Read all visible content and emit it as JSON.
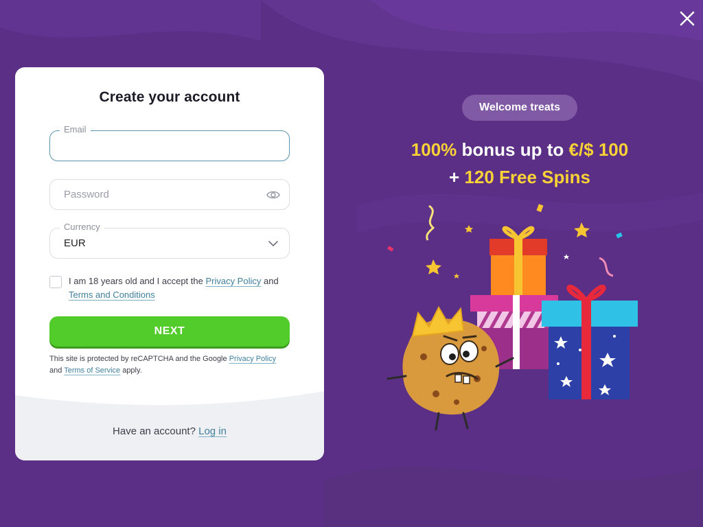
{
  "modal": {
    "title": "Create your account",
    "email": {
      "label": "Email",
      "value": "",
      "placeholder": ""
    },
    "password": {
      "placeholder": "Password"
    },
    "currency": {
      "label": "Currency",
      "value": "EUR"
    },
    "consent": {
      "text_before": "I am 18 years old and I accept the ",
      "privacy_link": "Privacy Policy",
      "text_middle": " and ",
      "terms_link": "Terms and Conditions"
    },
    "next_label": "NEXT",
    "recaptcha": {
      "text_before": "This site is protected by reCAPTCHA and the Google ",
      "privacy_link": "Privacy Policy",
      "text_middle": " and ",
      "terms_link": "Terms of Service",
      "text_after": " apply."
    },
    "login": {
      "prompt": "Have an account?",
      "link": "Log in"
    }
  },
  "promo": {
    "badge": "Welcome treats",
    "line1_a": "100%",
    "line1_b": " bonus up to ",
    "line1_c": "€/$ 100",
    "line2_a": "+ ",
    "line2_b": "120 Free Spins"
  },
  "colors": {
    "background": "#5b2f86",
    "accent_green": "#52cc2a",
    "highlight_yellow": "#f9d236",
    "link": "#3f7f9c"
  },
  "icons": [
    "close-icon",
    "eye-icon",
    "chevron-down-icon"
  ]
}
